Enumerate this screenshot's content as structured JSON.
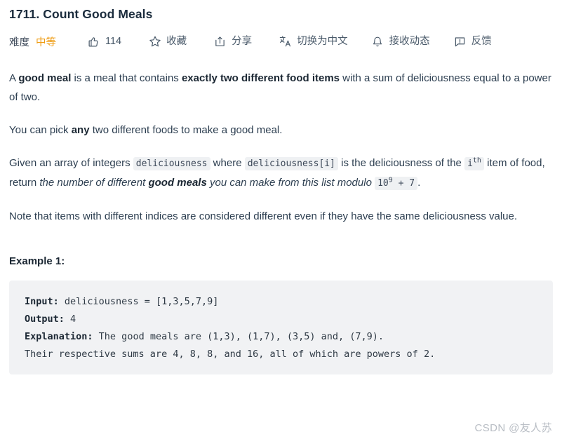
{
  "problem": {
    "title": "1711. Count Good Meals"
  },
  "toolbar": {
    "difficulty_label": "难度",
    "difficulty_value": "中等",
    "difficulty_color": "#ef9c13",
    "like_icon": "thumbs-up-icon",
    "like_count": "114",
    "favorite_icon": "star-icon",
    "favorite_label": "收藏",
    "share_icon": "share-icon",
    "share_label": "分享",
    "translate_icon": "translate-icon",
    "translate_label": "切换为中文",
    "subscribe_icon": "bell-icon",
    "subscribe_label": "接收动态",
    "feedback_icon": "feedback-icon",
    "feedback_label": "反馈"
  },
  "description": {
    "p1": {
      "t1": "A ",
      "b1": "good meal",
      "t2": " is a meal that contains ",
      "b2": "exactly two different food items",
      "t3": " with a sum of deliciousness equal to a power of two."
    },
    "p2": {
      "t1": "You can pick ",
      "b1": "any",
      "t2": " two different foods to make a good meal."
    },
    "p3": {
      "t1": "Given an array of integers ",
      "c1": "deliciousness",
      "t2": " where ",
      "c2": "deliciousness[i]",
      "t3": " is the deliciousness of the ",
      "c3": "i",
      "c3sup": "th",
      "t4": " item of food, return ",
      "i1": "the number of different ",
      "ib1": "good meals",
      "i2": " you can make from this list modulo",
      "t5": " ",
      "c4": "10",
      "c4sup": "9",
      "c4b": " + 7",
      "t6": "."
    },
    "p4": {
      "t1": "Note that items with different indices are considered different even if they have the same deliciousness value."
    }
  },
  "example": {
    "heading": "Example 1:",
    "input_label": "Input:",
    "input_value": " deliciousness = [1,3,5,7,9]",
    "output_label": "Output:",
    "output_value": " 4",
    "explanation_label": "Explanation:",
    "explanation_value": " The good meals are (1,3), (1,7), (3,5) and, (7,9).",
    "explanation_line2": "Their respective sums are 4, 8, 8, and 16, all of which are powers of 2."
  },
  "watermark": {
    "text": "CSDN @友人苏"
  }
}
